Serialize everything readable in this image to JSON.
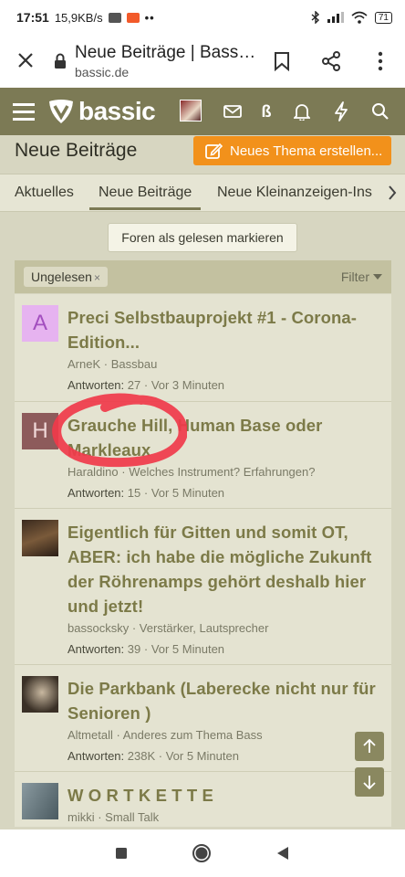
{
  "status": {
    "time": "17:51",
    "speed": "15,9KB/s",
    "dots": "••",
    "battery": "71"
  },
  "browser": {
    "title": "Neue Beiträge | Bassic...",
    "url": "bassic.de"
  },
  "site": {
    "logo_text": "bassic",
    "notifications_letter": "ß"
  },
  "page": {
    "title": "Neue Beiträge",
    "new_thread_label": "Neues Thema erstellen..."
  },
  "tabs": [
    {
      "label": "Aktuelles"
    },
    {
      "label": "Neue Beiträge"
    },
    {
      "label": "Neue Kleinanzeigen-Ins"
    }
  ],
  "mark_read_label": "Foren als gelesen markieren",
  "filter": {
    "chip_label": "Ungelesen",
    "chip_close": "×",
    "filter_label": "Filter"
  },
  "threads": [
    {
      "avatar_letter": "A",
      "avatar_color": "#e6b3f0",
      "avatar_text_color": "#a34fbf",
      "title": "Preci Selbstbauprojekt #1 - Corona-Edition...",
      "author": "ArneK",
      "forum": "Bassbau",
      "replies_label": "Antworten:",
      "replies": "27",
      "time": "Vor 3 Minuten"
    },
    {
      "avatar_letter": "H",
      "avatar_color": "#8d5b5b",
      "avatar_text_color": "#f0d8d8",
      "title": "Grauche Hill, Human Base oder Markleaux",
      "author": "Haraldino",
      "forum": "Welches Instrument? Erfahrungen?",
      "replies_label": "Antworten:",
      "replies": "15",
      "time": "Vor 5 Minuten"
    },
    {
      "avatar_letter": "",
      "avatar_color": "#4a3a2a",
      "avatar_text_color": "#ffffff",
      "title": "Eigentlich für Gitten und somit OT, ABER: ich habe die mögliche Zukunft der Röhrenamps gehört deshalb hier und jetzt!",
      "author": "bassocksky",
      "forum": "Verstärker, Lautsprecher",
      "replies_label": "Antworten:",
      "replies": "39",
      "time": "Vor 5 Minuten"
    },
    {
      "avatar_letter": "",
      "avatar_color": "#3a3026",
      "avatar_text_color": "#ffffff",
      "title": "Die Parkbank (Laberecke nicht nur für Senioren )",
      "author": "Altmetall",
      "forum": "Anderes zum Thema Bass",
      "replies_label": "Antworten:",
      "replies": "238K",
      "time": "Vor 5 Minuten"
    },
    {
      "avatar_letter": "",
      "avatar_color": "#6a7a80",
      "avatar_text_color": "#ffffff",
      "title": "W O R T K E T T E",
      "author": "mikki",
      "forum": "Small Talk",
      "replies_label": "",
      "replies": "",
      "time": ""
    }
  ],
  "colors": {
    "header": "#7c7a55",
    "accent_orange": "#f2911b",
    "title_olive": "#7c7a48",
    "annotation_red": "#f03a4a"
  }
}
